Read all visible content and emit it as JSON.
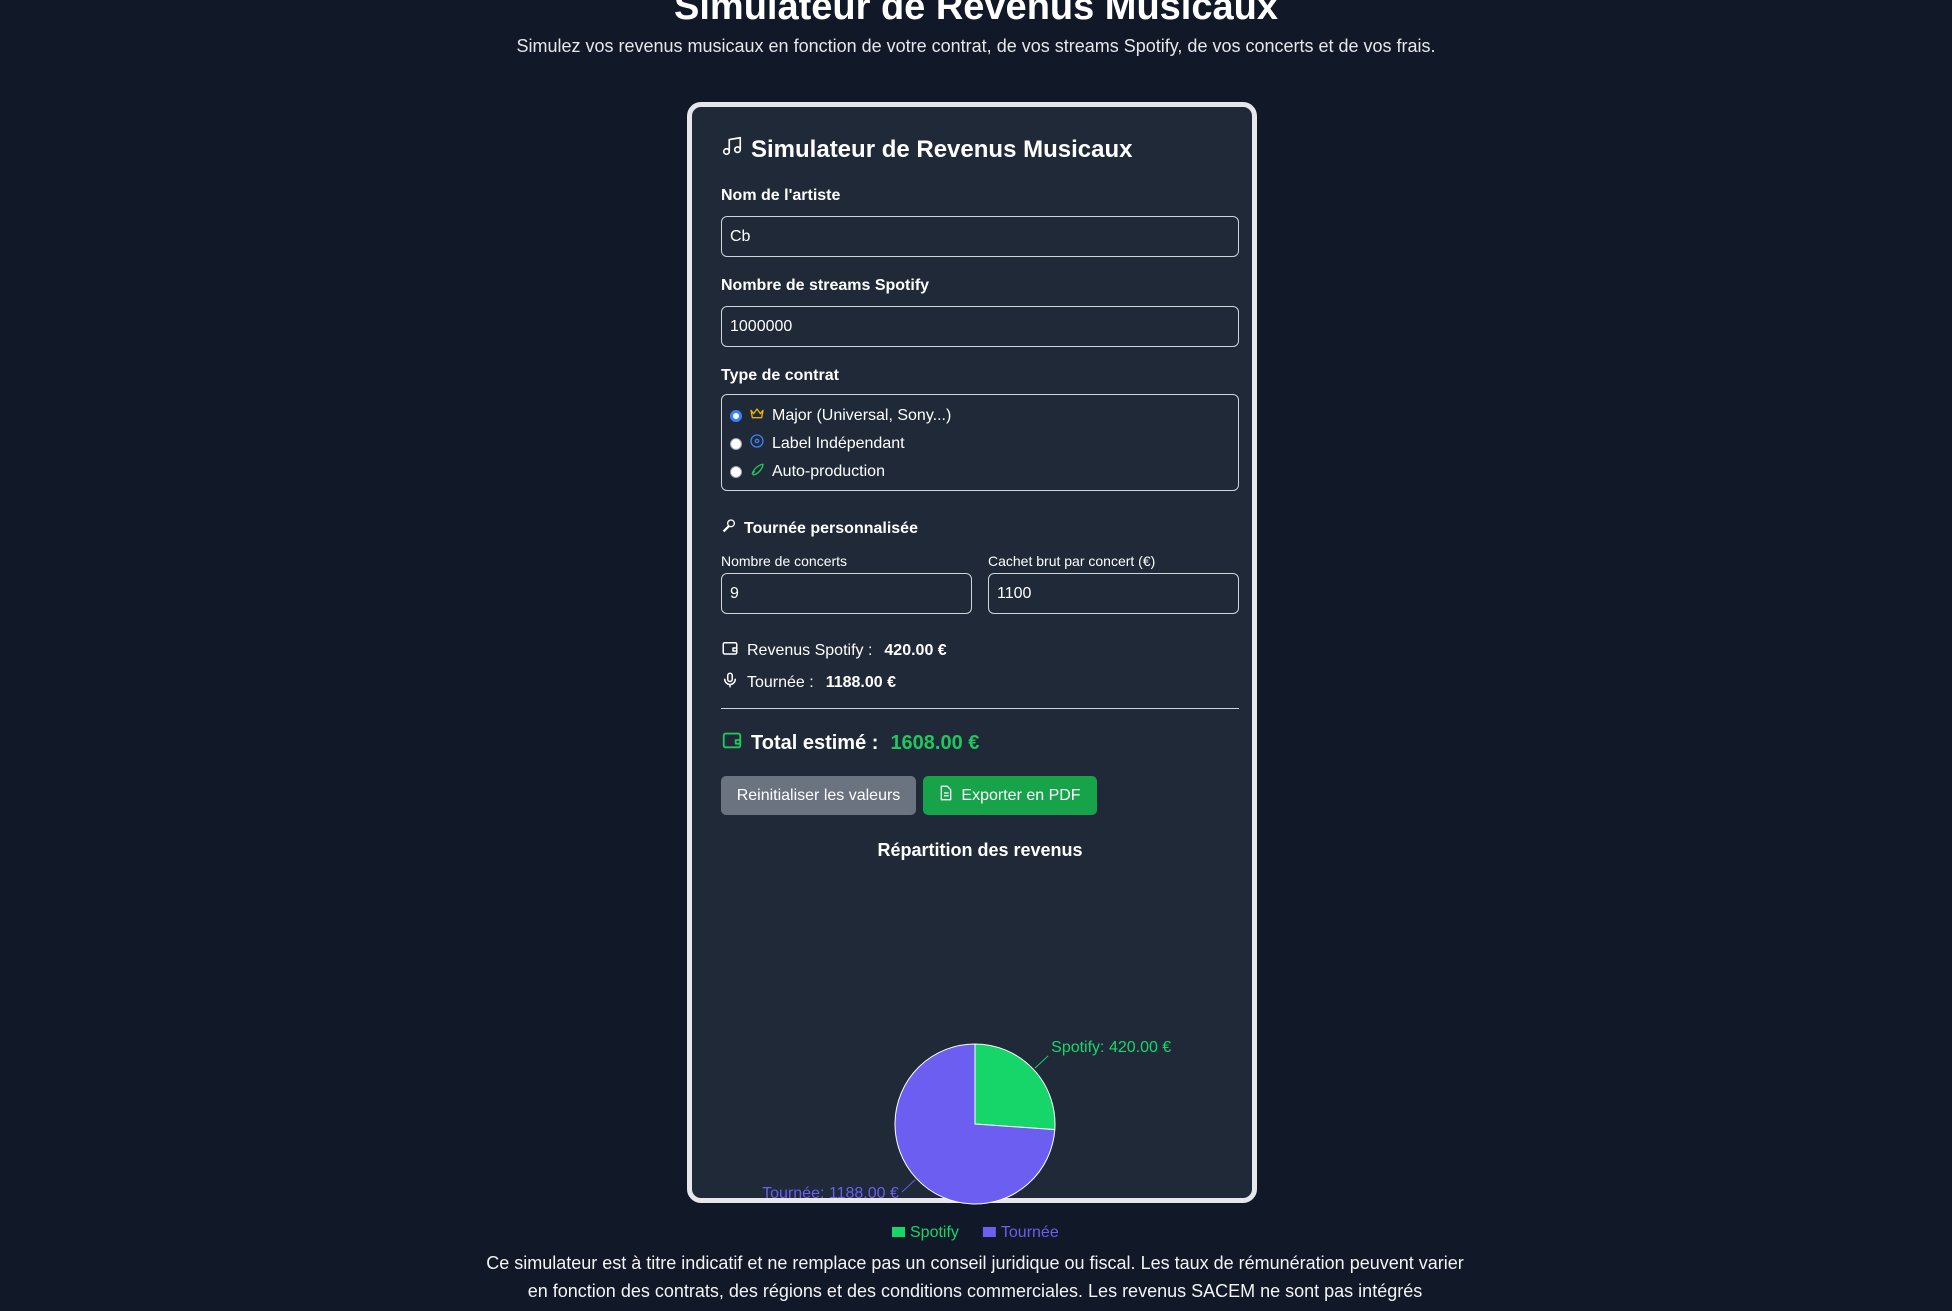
{
  "page": {
    "title": "Simulateur de Revenus Musicaux",
    "subtitle": "Simulez vos revenus musicaux en fonction de votre contrat, de vos streams Spotify, de vos concerts et de vos frais.",
    "footer": "Ce simulateur est à titre indicatif et ne remplace pas un conseil juridique ou fiscal. Les taux de rémunération peuvent varier en fonction des contrats, des régions et des conditions commerciales. Les revenus SACEM ne sont pas intégrés"
  },
  "card": {
    "title": "Simulateur de Revenus Musicaux",
    "artist_label": "Nom de l'artiste",
    "artist_value": "Cb",
    "streams_label": "Nombre de streams Spotify",
    "streams_value": "1000000",
    "contract_label": "Type de contrat",
    "contract_options": [
      {
        "label": "Major (Universal, Sony...)",
        "icon": "crown-icon",
        "checked": true
      },
      {
        "label": "Label Indépendant",
        "icon": "record-icon",
        "checked": false
      },
      {
        "label": "Auto-production",
        "icon": "rocket-icon",
        "checked": false
      }
    ],
    "tour_title": "Tournée personnalisée",
    "concerts_label": "Nombre de concerts",
    "concerts_value": "9",
    "fee_label": "Cachet brut par concert (€)",
    "fee_value": "1100",
    "spotify_label": "Revenus Spotify :",
    "spotify_value": "420.00 €",
    "tour_label": "Tournée :",
    "tour_value": "1188.00 €",
    "total_label": "Total estimé :",
    "total_value": "1608.00 €",
    "reset_label": "Reinitialiser les valeurs",
    "export_label": "Exporter en PDF"
  },
  "colors": {
    "background": "#111827",
    "card": "#1f2937",
    "spotify": "#16d669",
    "tour": "#6b5ef0",
    "total": "#22c55e",
    "reset_button": "#6b7280",
    "export_button": "#16a34a"
  },
  "chart_data": {
    "type": "pie",
    "title": "Répartition des revenus",
    "categories": [
      "Spotify",
      "Tournée"
    ],
    "values": [
      420.0,
      1188.0
    ],
    "labels": [
      "Spotify: 420.00 €",
      "Tournée: 1188.00 €"
    ],
    "colors": [
      "#16d669",
      "#6b5ef0"
    ],
    "legend": [
      "Spotify",
      "Tournée"
    ],
    "legend_position": "bottom"
  }
}
